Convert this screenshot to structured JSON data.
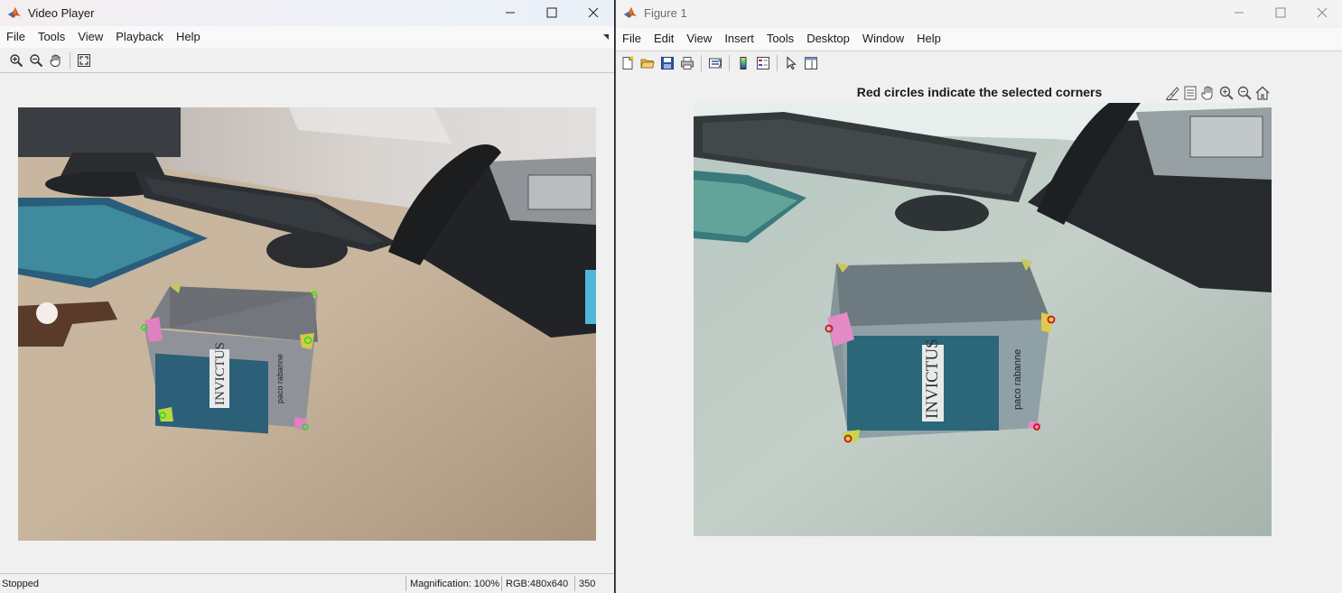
{
  "video_player": {
    "title": "Video Player",
    "menu": [
      "File",
      "Tools",
      "View",
      "Playback",
      "Help"
    ],
    "toolbar_icons": [
      "zoom-in-icon",
      "zoom-out-icon",
      "pan-hand-icon",
      "fit-to-window-icon"
    ],
    "status": {
      "state": "Stopped",
      "magnification": "Magnification: 100%",
      "rgb": "RGB:480x640",
      "frame": "350"
    }
  },
  "figure": {
    "title": "Figure 1",
    "menu": [
      "File",
      "Edit",
      "View",
      "Insert",
      "Tools",
      "Desktop",
      "Window",
      "Help"
    ],
    "toolbar_icons": [
      "new-figure-icon",
      "open-file-icon",
      "save-icon",
      "print-icon",
      "link-plot-icon",
      "colorbar-icon",
      "legend-icon",
      "edit-plot-icon",
      "property-inspector-icon"
    ],
    "axes_title": "Red circles indicate the selected corners",
    "axes_toolbar_icons": [
      "brush-icon",
      "data-tips-icon",
      "pan-icon",
      "zoom-in-icon",
      "zoom-out-icon",
      "restore-view-icon"
    ]
  },
  "book": {
    "brand": "INVICTUS",
    "maker": "paco rabanne"
  },
  "colors": {
    "green_marker": "#22dd22",
    "red_marker": "#d01010",
    "window_bg": "#f0f0f0"
  }
}
